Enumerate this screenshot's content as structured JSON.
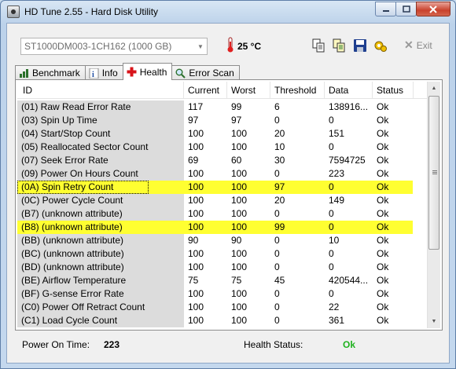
{
  "window": {
    "title": "HD Tune 2.55 - Hard Disk Utility"
  },
  "toolbar": {
    "drive": "ST1000DM003-1CH162 (1000 GB)",
    "temperature": "25 °C",
    "exit_label": "Exit"
  },
  "tabs": [
    {
      "label": "Benchmark",
      "active": false
    },
    {
      "label": "Info",
      "active": false
    },
    {
      "label": "Health",
      "active": true
    },
    {
      "label": "Error Scan",
      "active": false
    }
  ],
  "table": {
    "columns": [
      "ID",
      "Current",
      "Worst",
      "Threshold",
      "Data",
      "Status"
    ],
    "rows": [
      {
        "id": "(01) Raw Read Error Rate",
        "current": "117",
        "worst": "99",
        "threshold": "6",
        "data": "138916...",
        "status": "Ok",
        "highlight": false
      },
      {
        "id": "(03) Spin Up Time",
        "current": "97",
        "worst": "97",
        "threshold": "0",
        "data": "0",
        "status": "Ok",
        "highlight": false
      },
      {
        "id": "(04) Start/Stop Count",
        "current": "100",
        "worst": "100",
        "threshold": "20",
        "data": "151",
        "status": "Ok",
        "highlight": false
      },
      {
        "id": "(05) Reallocated Sector Count",
        "current": "100",
        "worst": "100",
        "threshold": "10",
        "data": "0",
        "status": "Ok",
        "highlight": false
      },
      {
        "id": "(07) Seek Error Rate",
        "current": "69",
        "worst": "60",
        "threshold": "30",
        "data": "7594725",
        "status": "Ok",
        "highlight": false
      },
      {
        "id": "(09) Power On Hours Count",
        "current": "100",
        "worst": "100",
        "threshold": "0",
        "data": "223",
        "status": "Ok",
        "highlight": false
      },
      {
        "id": "(0A) Spin Retry Count",
        "current": "100",
        "worst": "100",
        "threshold": "97",
        "data": "0",
        "status": "Ok",
        "highlight": true,
        "selected": true
      },
      {
        "id": "(0C) Power Cycle Count",
        "current": "100",
        "worst": "100",
        "threshold": "20",
        "data": "149",
        "status": "Ok",
        "highlight": false
      },
      {
        "id": "(B7) (unknown attribute)",
        "current": "100",
        "worst": "100",
        "threshold": "0",
        "data": "0",
        "status": "Ok",
        "highlight": false
      },
      {
        "id": "(B8) (unknown attribute)",
        "current": "100",
        "worst": "100",
        "threshold": "99",
        "data": "0",
        "status": "Ok",
        "highlight": true
      },
      {
        "id": "(BB) (unknown attribute)",
        "current": "90",
        "worst": "90",
        "threshold": "0",
        "data": "10",
        "status": "Ok",
        "highlight": false
      },
      {
        "id": "(BC) (unknown attribute)",
        "current": "100",
        "worst": "100",
        "threshold": "0",
        "data": "0",
        "status": "Ok",
        "highlight": false
      },
      {
        "id": "(BD) (unknown attribute)",
        "current": "100",
        "worst": "100",
        "threshold": "0",
        "data": "0",
        "status": "Ok",
        "highlight": false
      },
      {
        "id": "(BE) Airflow Temperature",
        "current": "75",
        "worst": "75",
        "threshold": "45",
        "data": "420544...",
        "status": "Ok",
        "highlight": false
      },
      {
        "id": "(BF) G-sense Error Rate",
        "current": "100",
        "worst": "100",
        "threshold": "0",
        "data": "0",
        "status": "Ok",
        "highlight": false
      },
      {
        "id": "(C0) Power Off Retract Count",
        "current": "100",
        "worst": "100",
        "threshold": "0",
        "data": "22",
        "status": "Ok",
        "highlight": false
      },
      {
        "id": "(C1) Load Cycle Count",
        "current": "100",
        "worst": "100",
        "threshold": "0",
        "data": "361",
        "status": "Ok",
        "highlight": false
      }
    ]
  },
  "status_bar": {
    "power_on_label": "Power On Time:",
    "power_on_value": "223",
    "health_label": "Health Status:",
    "health_value": "Ok"
  },
  "colors": {
    "highlight": "#ffff31",
    "ok_green": "#1fb21f"
  },
  "icons": [
    "disk-icon",
    "thermometer-icon",
    "copy-icon",
    "copy-all-icon",
    "save-icon",
    "options-icon",
    "exit-icon",
    "benchmark-icon",
    "info-icon",
    "health-icon",
    "error-scan-icon"
  ]
}
